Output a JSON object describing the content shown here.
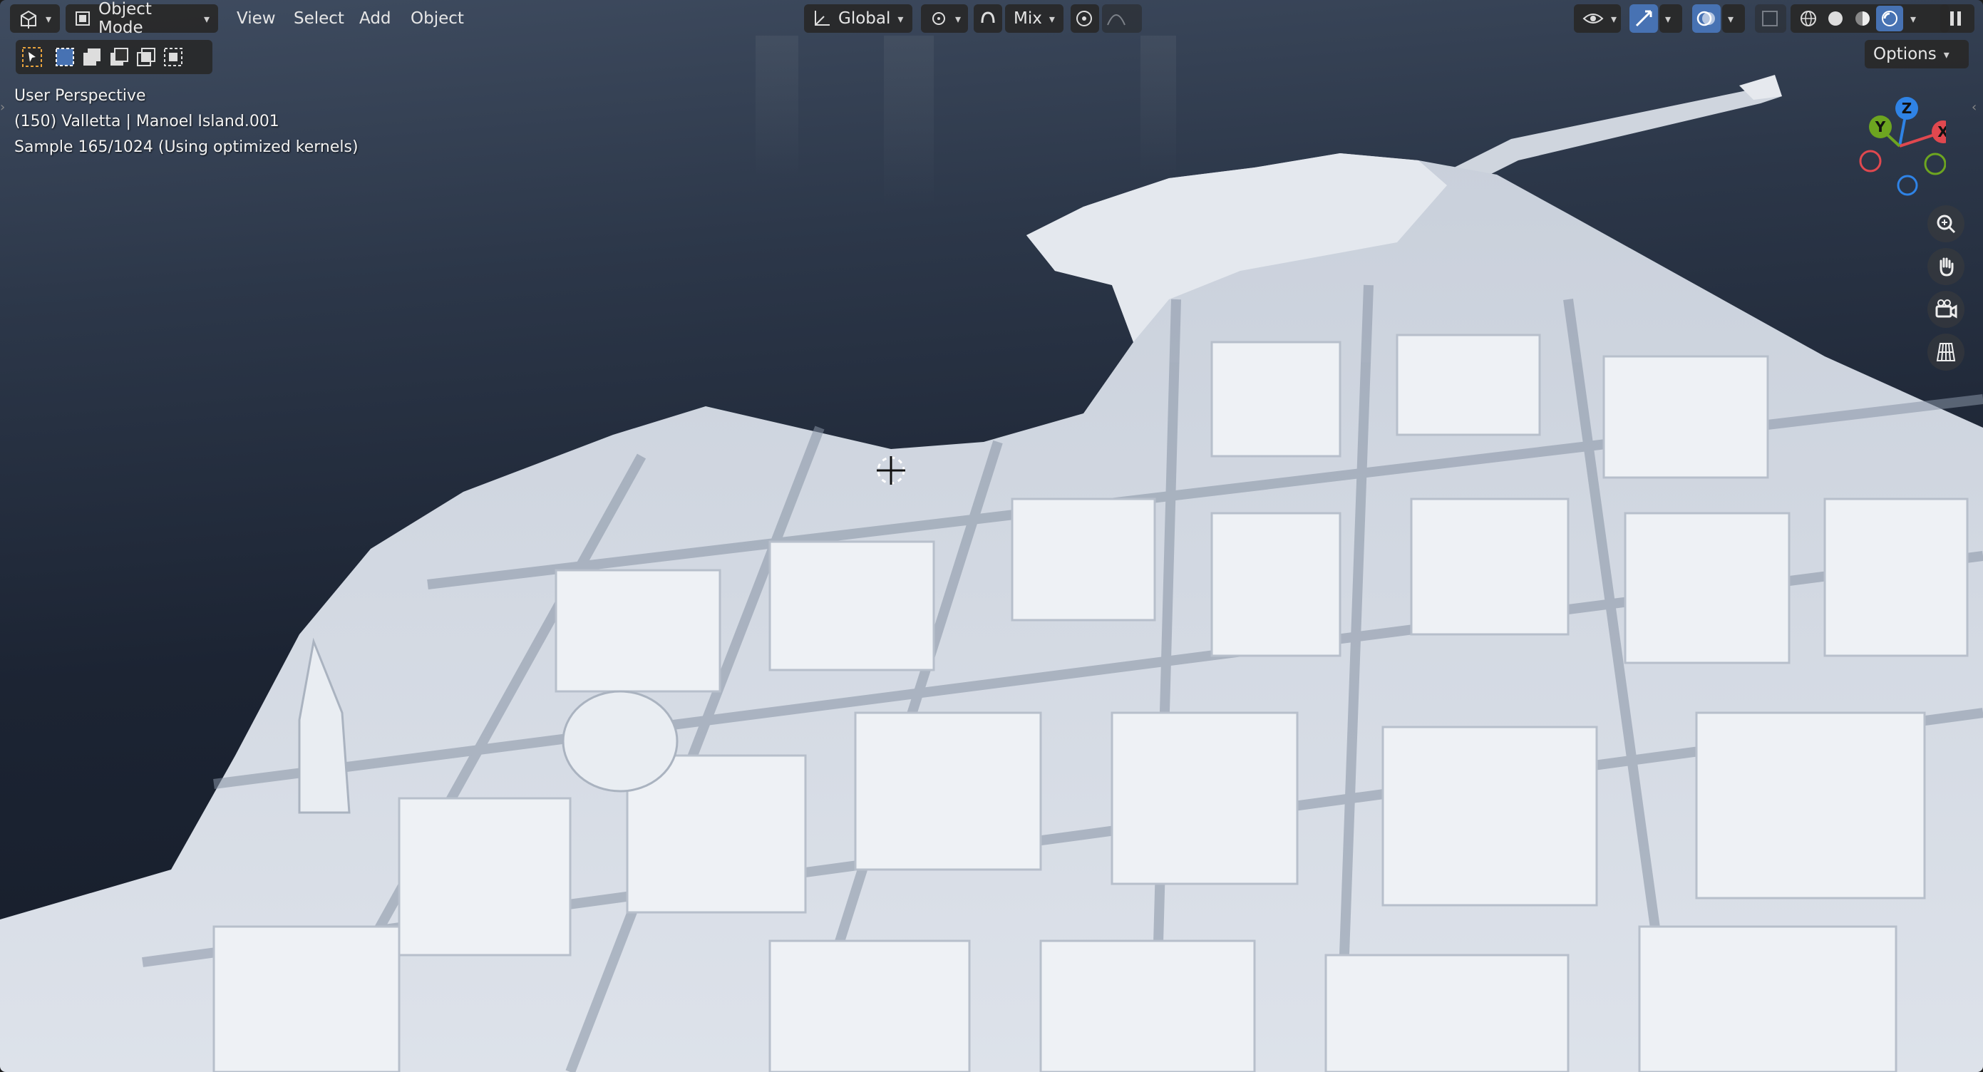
{
  "header": {
    "editor_type_icon": "3d-viewport-icon",
    "mode_label": "Object Mode",
    "menus": [
      "View",
      "Select",
      "Add",
      "Object"
    ],
    "orientation_label": "Global",
    "pivot_icon": "pivot-icon",
    "snap_icon": "snap-icon",
    "proportional_label": "Mix",
    "proportional_icon": "proportional-edit-icon",
    "falloff_icon": "falloff-curve-icon",
    "visibility_icon": "eye-icon",
    "gizmo_icon": "gizmo-icon",
    "overlay_icon": "overlay-icon",
    "xray_icon": "xray-icon",
    "shading_icons": [
      "wireframe-shading-icon",
      "solid-shading-icon",
      "material-shading-icon",
      "rendered-shading-icon"
    ],
    "pause_icon": "pause-icon"
  },
  "toolbar": {
    "options_label": "Options",
    "select_tool_icon": "select-tool-icon",
    "select_modes": [
      "select-new-icon",
      "select-extend-icon",
      "select-subtract-icon",
      "select-invert-icon",
      "select-intersect-icon"
    ]
  },
  "viewport_info": {
    "line1": "User Perspective",
    "line2": "(150) Valletta | Manoel Island.001",
    "line3": "Sample 165/1024 (Using optimized kernels)"
  },
  "gizmo": {
    "z": "Z",
    "y": "Y",
    "x": "X",
    "colors": {
      "x": "#e0484f",
      "y": "#6da520",
      "z": "#2f83e6"
    }
  },
  "nav_tools": [
    "zoom-icon",
    "pan-hand-icon",
    "camera-view-icon",
    "ortho-grid-icon"
  ],
  "colors": {
    "accent": "#4772b3",
    "header_bg": "#282828",
    "water": "#1c2433",
    "buildings": "#e8ecf2"
  }
}
